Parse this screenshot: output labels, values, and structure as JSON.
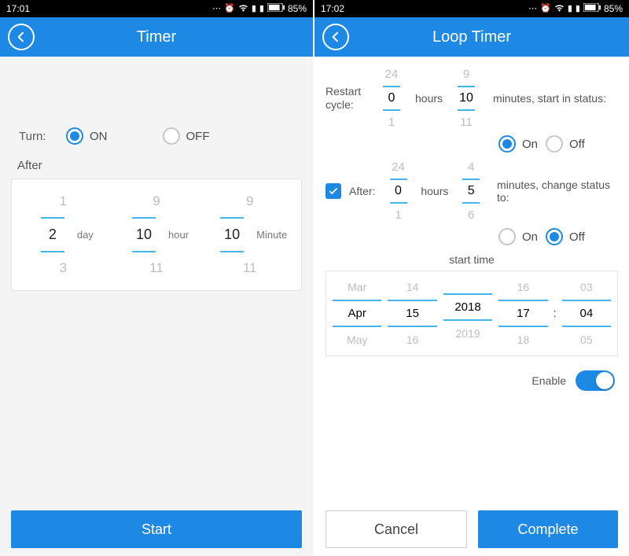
{
  "colors": {
    "accent": "#1e88e5",
    "picker_line": "#42b6e9"
  },
  "left": {
    "status": {
      "time": "17:01",
      "battery": "85%"
    },
    "header": {
      "title": "Timer"
    },
    "turn": {
      "label": "Turn:",
      "on": "ON",
      "off": "OFF",
      "selected": "on"
    },
    "after_label": "After",
    "day": {
      "prev": "1",
      "sel": "2",
      "next": "3",
      "unit": "day"
    },
    "hour": {
      "prev": "9",
      "sel": "10",
      "next": "11",
      "unit": "hour"
    },
    "minute": {
      "prev": "9",
      "sel": "10",
      "next": "11",
      "unit": "Minute"
    },
    "start_button": "Start"
  },
  "right": {
    "status": {
      "time": "17:02",
      "battery": "85%"
    },
    "header": {
      "title": "Loop Timer"
    },
    "restart": {
      "label": "Restart cycle:",
      "hours": {
        "prev": "24",
        "sel": "0",
        "next": "1"
      },
      "hours_word": "hours",
      "minutes": {
        "prev": "9",
        "sel": "10",
        "next": "11"
      },
      "rest": "minutes, start in status:",
      "on": "On",
      "off": "Off",
      "selected": "on"
    },
    "after": {
      "checked": true,
      "label": "After:",
      "hours": {
        "prev": "24",
        "sel": "0",
        "next": "1"
      },
      "hours_word": "hours",
      "minutes": {
        "prev": "4",
        "sel": "5",
        "next": "6"
      },
      "rest": "minutes, change status to:",
      "on": "On",
      "off": "Off",
      "selected": "off"
    },
    "start_time_label": "start time",
    "datetime": {
      "month": {
        "prev": "Mar",
        "sel": "Apr",
        "next": "May"
      },
      "day": {
        "prev": "14",
        "sel": "15",
        "next": "16"
      },
      "year": {
        "prev": "",
        "sel": "2018",
        "next": "2019"
      },
      "hour": {
        "prev": "16",
        "sel": "17",
        "next": "18"
      },
      "minute": {
        "prev": "03",
        "sel": "04",
        "next": "05"
      }
    },
    "enable_label": "Enable",
    "enable_on": true,
    "cancel_button": "Cancel",
    "complete_button": "Complete"
  }
}
